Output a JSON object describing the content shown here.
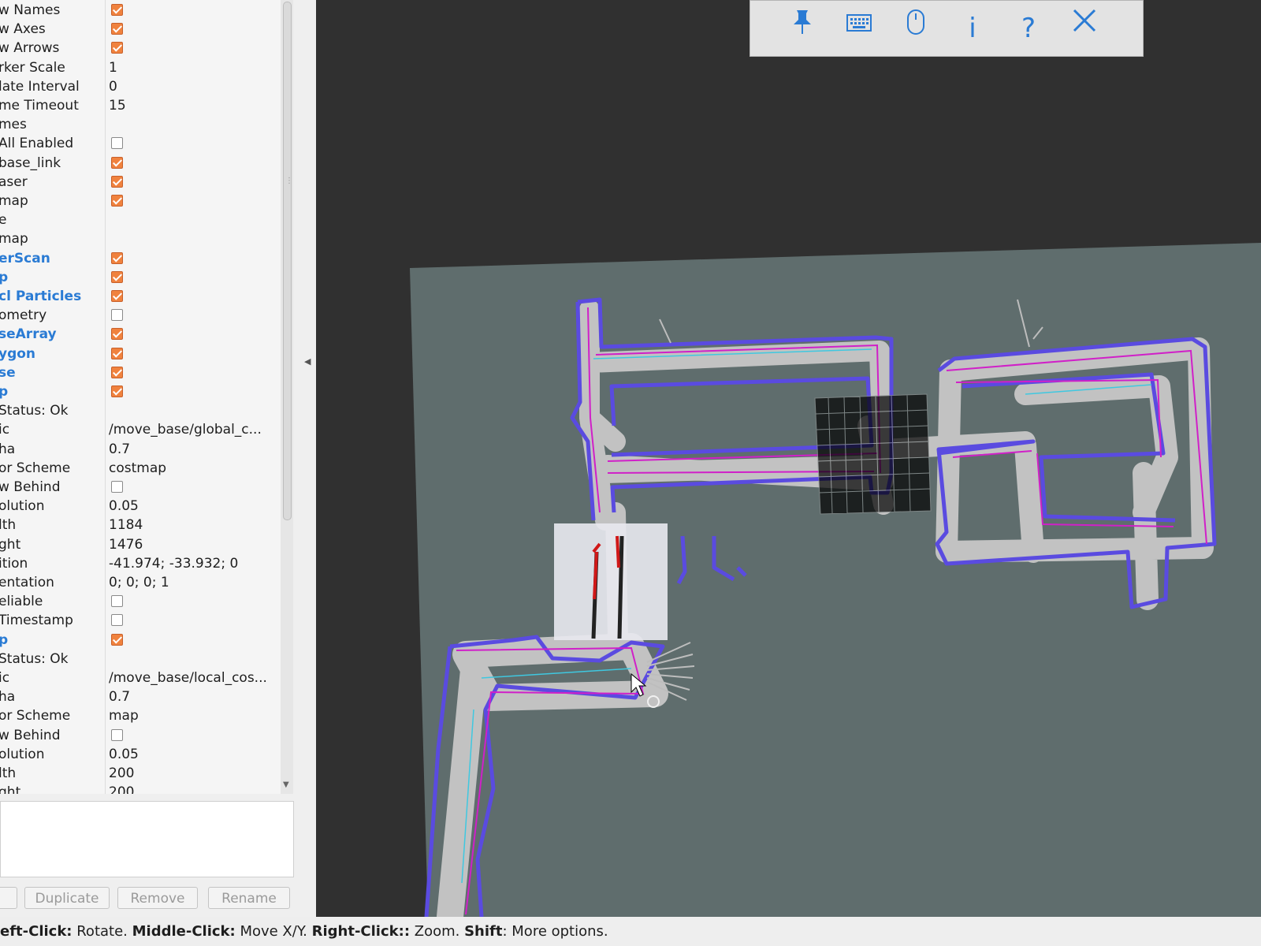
{
  "properties": [
    {
      "name": "w Names",
      "check": true
    },
    {
      "name": "w Axes",
      "check": true
    },
    {
      "name": "w Arrows",
      "check": true
    },
    {
      "name": "rker Scale",
      "value": "1"
    },
    {
      "name": "late Interval",
      "value": "0"
    },
    {
      "name": "me Timeout",
      "value": "15"
    },
    {
      "name": "mes"
    },
    {
      "name": "All Enabled",
      "check": false
    },
    {
      "name": "base_link",
      "check": true
    },
    {
      "name": "aser",
      "check": true
    },
    {
      "name": "map",
      "check": true
    },
    {
      "name": "e"
    },
    {
      "name": "map"
    },
    {
      "name": "erScan",
      "check": true,
      "blue": true
    },
    {
      "name": "p",
      "check": true,
      "blue": true
    },
    {
      "name": "cl Particles",
      "check": true,
      "blue": true
    },
    {
      "name": "ometry",
      "check": false
    },
    {
      "name": "seArray",
      "check": true,
      "blue": true
    },
    {
      "name": "ygon",
      "check": true,
      "blue": true
    },
    {
      "name": "se",
      "check": true,
      "blue": true
    },
    {
      "name": "p",
      "check": true,
      "blue": true
    },
    {
      "name": "Status: Ok"
    },
    {
      "name": "ic",
      "value": "/move_base/global_c..."
    },
    {
      "name": "ha",
      "value": "0.7"
    },
    {
      "name": "or Scheme",
      "value": "costmap"
    },
    {
      "name": "w Behind",
      "check": false
    },
    {
      "name": "olution",
      "value": "0.05"
    },
    {
      "name": "lth",
      "value": "1184"
    },
    {
      "name": "ght",
      "value": "1476"
    },
    {
      "name": "ition",
      "value": "-41.974; -33.932; 0"
    },
    {
      "name": "entation",
      "value": "0; 0; 0; 1"
    },
    {
      "name": "eliable",
      "check": false
    },
    {
      "name": " Timestamp",
      "check": false
    },
    {
      "name": "p",
      "check": true,
      "blue": true
    },
    {
      "name": "Status: Ok"
    },
    {
      "name": "ic",
      "value": "/move_base/local_cos..."
    },
    {
      "name": "ha",
      "value": "0.7"
    },
    {
      "name": "or Scheme",
      "value": "map"
    },
    {
      "name": "w Behind",
      "check": false
    },
    {
      "name": "olution",
      "value": "0.05"
    },
    {
      "name": "lth",
      "value": "200"
    },
    {
      "name": "ght",
      "value": "200"
    }
  ],
  "buttons": {
    "duplicate": "Duplicate",
    "remove": "Remove",
    "rename": "Rename"
  },
  "toolbar": {
    "icons": [
      "pin-icon",
      "keyboard-icon",
      "mouse-icon",
      "info-icon",
      "help-icon",
      "close-icon"
    ]
  },
  "status": {
    "left_click": "eft-Click:",
    "rotate": " Rotate. ",
    "middle_click": "Middle-Click:",
    "move": " Move X/Y. ",
    "right_click": "Right-Click::",
    "zoom": " Zoom. ",
    "shift": "Shift",
    "more": ": More options."
  },
  "colors": {
    "accent": "#2a7bd4",
    "check": "#f0823e",
    "viewport_bg": "#303030",
    "map_unknown": "#5f6d6d",
    "map_free": "#c2c2c2",
    "inflation": "#5a4be0",
    "obstacle": "#d020c8"
  }
}
